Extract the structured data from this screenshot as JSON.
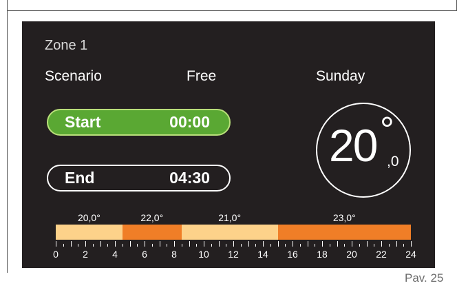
{
  "header": {
    "zone": "Zone 1"
  },
  "info": {
    "scenario_label": "Scenario",
    "mode_value": "Free",
    "day": "Sunday"
  },
  "start": {
    "label": "Start",
    "time": "00:00"
  },
  "end": {
    "label": "End",
    "time": "04:30"
  },
  "temperature": {
    "integer": "20",
    "degree": "°",
    "decimal": ",0"
  },
  "schedule": {
    "segments": [
      {
        "from_h": 0,
        "to_h": 4.5,
        "temp": "20,0°",
        "color": "#fdd28a"
      },
      {
        "from_h": 4.5,
        "to_h": 8.5,
        "temp": "22,0°",
        "color": "#f07e27"
      },
      {
        "from_h": 8.5,
        "to_h": 15,
        "temp": "21,0°",
        "color": "#fdd28a"
      },
      {
        "from_h": 15,
        "to_h": 24,
        "temp": "23,0°",
        "color": "#f07e27"
      }
    ],
    "axis_labels": [
      "0",
      "2",
      "4",
      "6",
      "8",
      "10",
      "12",
      "14",
      "16",
      "18",
      "20",
      "22",
      "24"
    ]
  },
  "footer": {
    "page": "Pav. 25"
  }
}
